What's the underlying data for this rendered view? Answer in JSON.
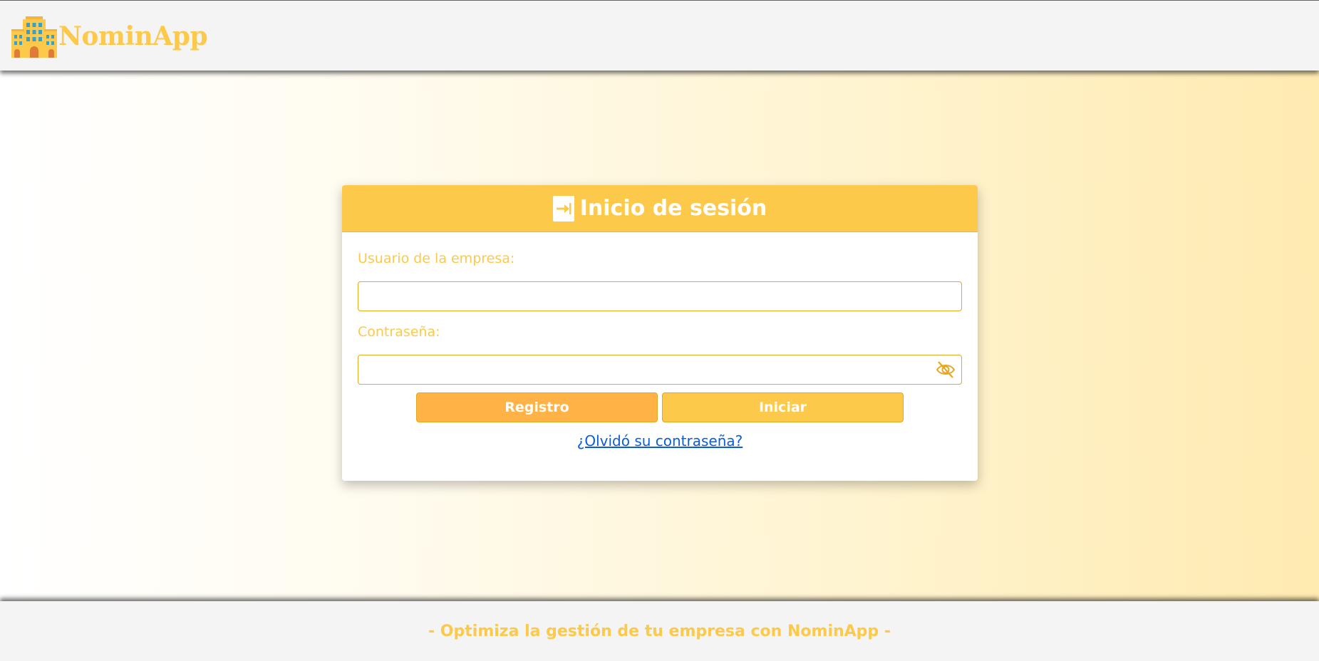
{
  "header": {
    "app_name": "NominApp",
    "logo_icon": "building-icon"
  },
  "login": {
    "title": "Inicio de sesión",
    "title_icon": "login-arrow-icon",
    "user_label": "Usuario de la empresa:",
    "user_value": "",
    "password_label": "Contraseña:",
    "password_value": "",
    "toggle_icon": "eye-off-icon",
    "register_label": "Registro",
    "submit_label": "Iniciar",
    "forgot_label": "¿Olvidó su contraseña?"
  },
  "footer": {
    "tagline": "- Optimiza la gestión de tu empresa con NominApp -"
  },
  "colors": {
    "brand_yellow": "#fcc94a",
    "register_orange": "#ffb347",
    "link_blue": "#0b5ed7",
    "input_border": "#e6a820"
  }
}
